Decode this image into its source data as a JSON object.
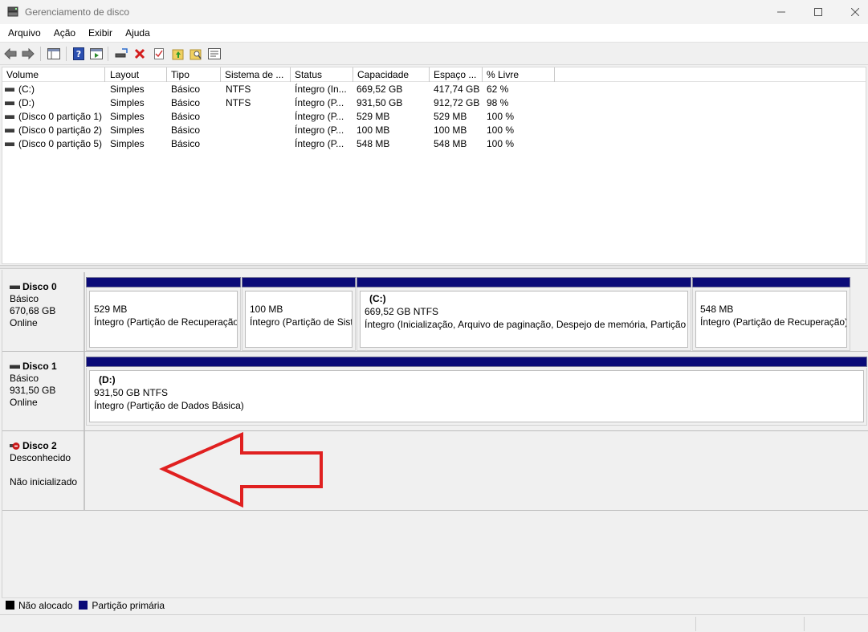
{
  "window": {
    "title": "Gerenciamento de disco"
  },
  "menu": [
    "Arquivo",
    "Ação",
    "Exibir",
    "Ajuda"
  ],
  "volume_list": {
    "columns": [
      "Volume",
      "Layout",
      "Tipo",
      "Sistema de ...",
      "Status",
      "Capacidade",
      "Espaço ...",
      "% Livre"
    ],
    "rows": [
      [
        "(C:)",
        "Simples",
        "Básico",
        "NTFS",
        "Íntegro (In...",
        "669,52 GB",
        "417,74 GB",
        "62 %"
      ],
      [
        "(D:)",
        "Simples",
        "Básico",
        "NTFS",
        "Íntegro (P...",
        "931,50 GB",
        "912,72 GB",
        "98 %"
      ],
      [
        "(Disco 0 partição 1)",
        "Simples",
        "Básico",
        "",
        "Íntegro (P...",
        "529 MB",
        "529 MB",
        "100 %"
      ],
      [
        "(Disco 0 partição 2)",
        "Simples",
        "Básico",
        "",
        "Íntegro (P...",
        "100 MB",
        "100 MB",
        "100 %"
      ],
      [
        "(Disco 0 partição 5)",
        "Simples",
        "Básico",
        "",
        "Íntegro (P...",
        "548 MB",
        "548 MB",
        "100 %"
      ]
    ]
  },
  "disks": [
    {
      "name": "Disco 0",
      "type": "Básico",
      "size": "670,68 GB",
      "state": "Online",
      "partitions": [
        {
          "title": "",
          "size": "529 MB",
          "status": "Íntegro (Partição de Recuperação)"
        },
        {
          "title": "",
          "size": "100 MB",
          "status": "Íntegro (Partição de Sistema EFI)"
        },
        {
          "title": "(C:)",
          "size": "669,52 GB NTFS",
          "status": "Íntegro (Inicialização, Arquivo de paginação, Despejo de memória, Partição de Dados Básica)"
        },
        {
          "title": "",
          "size": "548 MB",
          "status": "Íntegro (Partição de Recuperação)"
        }
      ]
    },
    {
      "name": "Disco 1",
      "type": "Básico",
      "size": "931,50 GB",
      "state": "Online",
      "partitions": [
        {
          "title": "(D:)",
          "size": "931,50 GB NTFS",
          "status": "Íntegro (Partição de Dados Básica)"
        }
      ]
    },
    {
      "name": "Disco 2",
      "type": "Desconhecido",
      "size": "",
      "state": "Não inicializado",
      "partitions": []
    }
  ],
  "legend": [
    {
      "label": "Não alocado",
      "color": "#000000"
    },
    {
      "label": "Partição primária",
      "color": "#0a0a78"
    }
  ],
  "annotation": {
    "color": "#e02020",
    "icon": "red-arrow-pointing-left"
  }
}
